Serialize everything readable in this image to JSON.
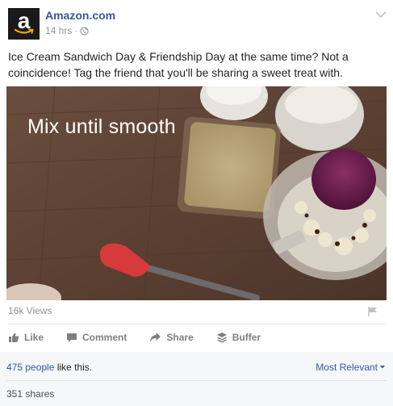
{
  "post": {
    "page_name": "Amazon.com",
    "time": "14 hrs",
    "text": "Ice Cream Sandwich Day & Friendship Day at the same time? Not a coincidence! Tag the friend that you'll be sharing a sweet treat with.",
    "logo_letter": "a"
  },
  "video": {
    "overlay_text": "Mix until smooth",
    "views": "16k Views"
  },
  "actions": {
    "like": "Like",
    "comment": "Comment",
    "share": "Share",
    "buffer": "Buffer"
  },
  "footer": {
    "likes_link": "475 people",
    "likes_rest": " like this.",
    "sort_label": "Most Relevant",
    "shares": "351 shares"
  },
  "colors": {
    "link": "#365899",
    "muted": "#90949c",
    "footer_bg": "#f6f7f9",
    "logo_bg": "#1a1a1a",
    "logo_smile": "#f7a51c"
  },
  "icons": [
    "chevron-down-icon",
    "globe-icon",
    "flag-icon",
    "thumbs-up-icon",
    "comment-icon",
    "share-icon",
    "buffer-icon",
    "caret-down-icon"
  ]
}
